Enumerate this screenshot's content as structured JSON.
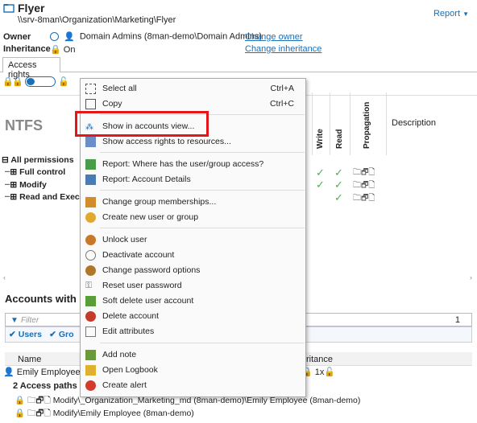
{
  "header": {
    "title": "Flyer",
    "path": "\\\\srv-8man\\Organization\\Marketing\\Flyer",
    "report_label": "Report"
  },
  "owner": {
    "label": "Owner",
    "value": "Domain Admins (8man-demo\\Domain Admins)",
    "change_link": "Change owner"
  },
  "inheritance": {
    "label": "Inheritance",
    "value": "On",
    "change_link": "Change inheritance"
  },
  "tab": {
    "label": "Access rights"
  },
  "ntfs": {
    "title": "NTFS",
    "columns": [
      "Write",
      "Read",
      "Propagation"
    ],
    "description_header": "Description",
    "tree": [
      "All permissions",
      "Full control",
      "Modify",
      "Read and Execut"
    ]
  },
  "accounts": {
    "title": "Accounts with pe",
    "filter_placeholder": "Filter",
    "filter_count": "1",
    "chips": [
      "Users",
      "Gro"
    ],
    "name_header": "Name",
    "inheritance_header": "ritance",
    "row_name": "Emily Employee",
    "row_inherit": "1x",
    "access_paths_label": "2 Access paths",
    "paths": [
      "Modify\\_Organization_Marketing_md (8man-demo)\\Emily Employee (8man-demo)",
      "Modify\\Emily Employee (8man-demo)"
    ]
  },
  "menu": {
    "items": [
      {
        "label": "Select all",
        "shortcut": "Ctrl+A"
      },
      {
        "label": "Copy",
        "shortcut": "Ctrl+C"
      },
      {
        "label": "Show in accounts view...",
        "shortcut": ""
      },
      {
        "label": "Show access rights to resources...",
        "shortcut": ""
      },
      {
        "label": "Report: Where has the user/group access?",
        "shortcut": ""
      },
      {
        "label": "Report: Account Details",
        "shortcut": ""
      },
      {
        "label": "Change group memberships...",
        "shortcut": ""
      },
      {
        "label": "Create new user or group",
        "shortcut": ""
      },
      {
        "label": "Unlock user",
        "shortcut": ""
      },
      {
        "label": "Deactivate account",
        "shortcut": ""
      },
      {
        "label": "Change password options",
        "shortcut": ""
      },
      {
        "label": "Reset user password",
        "shortcut": ""
      },
      {
        "label": "Soft delete user account",
        "shortcut": ""
      },
      {
        "label": "Delete account",
        "shortcut": ""
      },
      {
        "label": "Edit attributes",
        "shortcut": ""
      },
      {
        "label": "Add note",
        "shortcut": ""
      },
      {
        "label": "Open Logbook",
        "shortcut": ""
      },
      {
        "label": "Create alert",
        "shortcut": ""
      }
    ]
  },
  "colors": {
    "accent": "#1a6fb5",
    "highlight": "#e4161b",
    "check": "#4caf50"
  }
}
